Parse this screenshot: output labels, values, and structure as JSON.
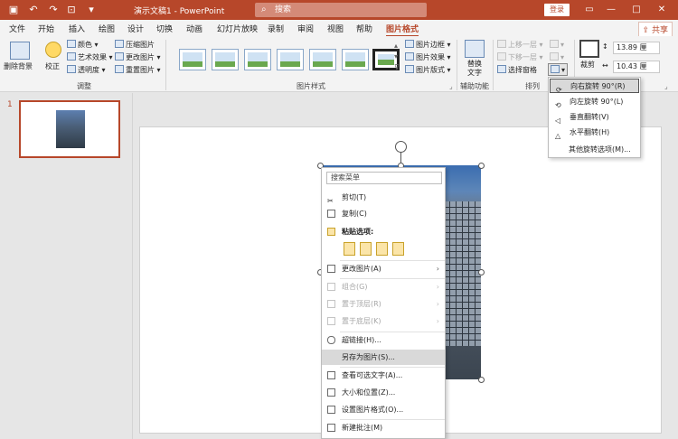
{
  "window": {
    "doc_title": "演示文稿1 - PowerPoint",
    "search_placeholder": "搜索",
    "login": "登录",
    "minimize": "—",
    "maximize": "□",
    "close": "✕"
  },
  "tabs": [
    "文件",
    "开始",
    "插入",
    "绘图",
    "设计",
    "切换",
    "动画",
    "幻灯片放映",
    "录制",
    "审阅",
    "视图",
    "帮助",
    "图片格式"
  ],
  "active_tab": "图片格式",
  "share": "共享",
  "ribbon": {
    "remove_bg": "删除背景",
    "correct": "校正",
    "color": "颜色",
    "art_effect": "艺术效果",
    "transparency": "透明度",
    "compress": "压缩图片",
    "change_pic": "更改图片",
    "reset_pic": "重置图片",
    "group_adjust": "调整",
    "group_styles": "图片样式",
    "border": "图片边框",
    "effect": "图片效果",
    "layout": "图片版式",
    "alt_text": "替换文字",
    "group_access": "辅助功能",
    "bring_forward": "上移一层",
    "send_backward": "下移一层",
    "selection_pane": "选择窗格",
    "group_arrange": "排列",
    "crop": "裁剪",
    "height": "13.89 厘",
    "width": "10.43 厘"
  },
  "slide_number": "1",
  "context_menu": {
    "search": "搜索菜单",
    "cut": "剪切(T)",
    "copy": "复制(C)",
    "paste_options": "粘贴选项:",
    "change_picture": "更改图片(A)",
    "group": "组合(G)",
    "bring_to_front": "置于顶层(R)",
    "send_to_back": "置于底层(K)",
    "hyperlink": "超链接(H)...",
    "save_as_picture": "另存为图片(S)...",
    "view_alt_text": "查看可选文字(A)...",
    "size_position": "大小和位置(Z)...",
    "format_picture": "设置图片格式(O)...",
    "new_comment": "新建批注(M)"
  },
  "rotate_menu": {
    "right90": "向右旋转 90°(R)",
    "left90": "向左旋转 90°(L)",
    "flip_v": "垂直翻转(V)",
    "flip_h": "水平翻转(H)",
    "more": "其他旋转选项(M)..."
  }
}
